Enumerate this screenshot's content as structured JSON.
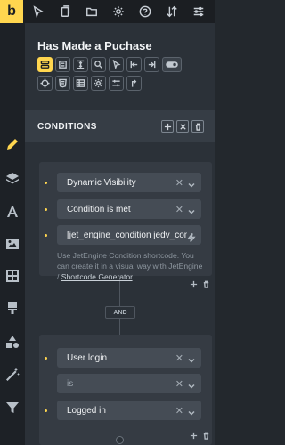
{
  "topbar": {
    "brand_letter": "b",
    "icons": [
      "cursor-icon",
      "copy-icon",
      "folder-icon",
      "gear-icon",
      "help-icon",
      "arrows-icon",
      "sliders-icon"
    ]
  },
  "sidebar": {
    "icons": [
      "pencil-icon",
      "layers-icon",
      "typography-icon",
      "image-icon",
      "grid-icon",
      "brush-icon",
      "shapes-icon",
      "magic-wand-icon",
      "filter-icon"
    ]
  },
  "element": {
    "title": "Has Made a Puchase"
  },
  "section": {
    "title": "CONDITIONS"
  },
  "condition_group_1": {
    "source": "Dynamic Visibility",
    "operator": "Condition is met",
    "value": "[jet_engine_condition jedv_con",
    "help_line1": "Use JetEngine Condition shortcode. You can create it in a visual way with JetEngine / ",
    "help_link": "Shortcode Generator",
    "help_end": "."
  },
  "and_label": "AND",
  "condition_group_2": {
    "source": "User login",
    "operator": "is",
    "value": "Logged in"
  },
  "colors": {
    "accent": "#ffd64f",
    "panel": "#2b3138",
    "sidebar": "#1d2126"
  }
}
